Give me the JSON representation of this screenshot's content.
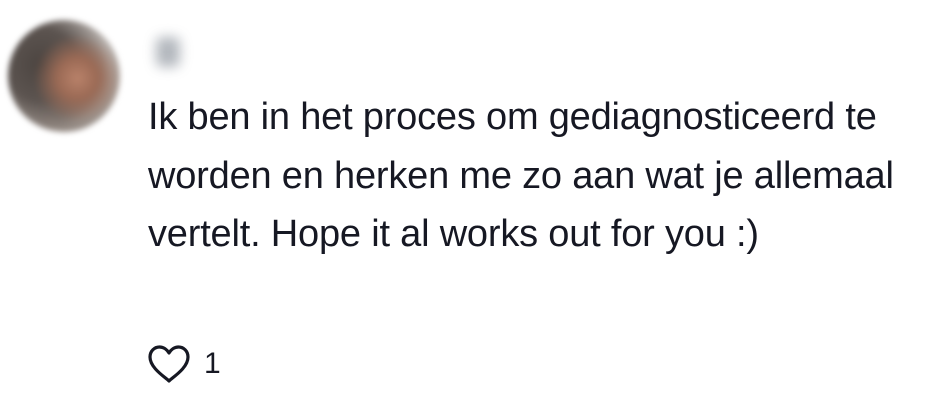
{
  "comment": {
    "username": "",
    "text": "Ik ben in het proces om gediagnosticeerd te worden en herken me zo aan wat je allemaal vertelt. Hope it al works out for you :)",
    "likes": "1",
    "like_icon": "heart-outline-icon"
  }
}
